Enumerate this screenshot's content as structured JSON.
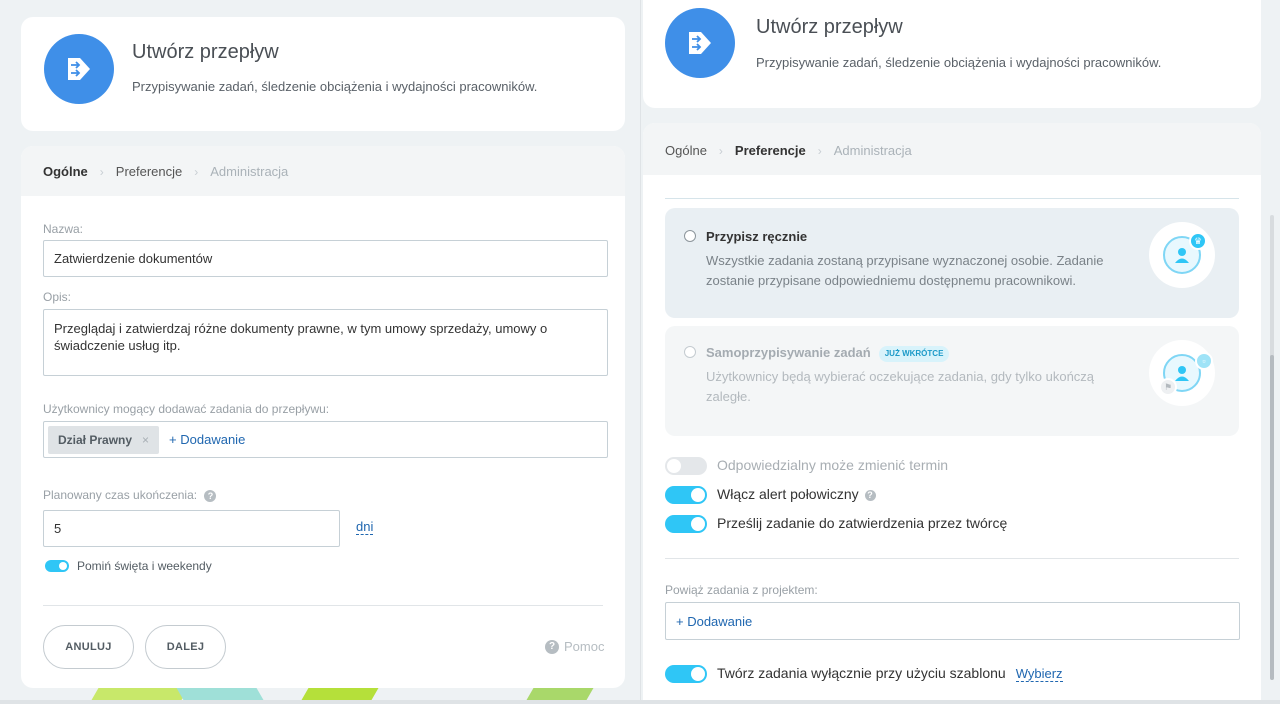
{
  "left": {
    "header": {
      "title": "Utwórz przepływ",
      "subtitle": "Przypisywanie zadań, śledzenie obciążenia i wydajności pracowników."
    },
    "tabs": [
      "Ogólne",
      "Preferencje",
      "Administracja"
    ],
    "form": {
      "name_label": "Nazwa:",
      "name_value": "Zatwierdzenie dokumentów",
      "desc_label": "Opis:",
      "desc_value": "Przeglądaj i zatwierdzaj różne dokumenty prawne, w tym umowy sprzedaży, umowy o świadczenie usług itp.",
      "users_label": "Użytkownicy mogący dodawać zadania do przepływu:",
      "users_chip": "Dział Prawny",
      "users_chip_remove": "×",
      "users_add": "+ Dodawanie",
      "time_label": "Planowany czas ukończenia:",
      "time_value": "5",
      "time_unit": "dni",
      "skip_toggle_label": "Pomiń święta i weekendy",
      "skip_toggle_on": true
    },
    "buttons": {
      "cancel": "ANULUJ",
      "next": "DALEJ",
      "help": "Pomoc"
    }
  },
  "right": {
    "header": {
      "title": "Utwórz przepływ",
      "subtitle": "Przypisywanie zadań, śledzenie obciążenia i wydajności pracowników."
    },
    "tabs": [
      "Ogólne",
      "Preferencje",
      "Administracja"
    ],
    "options": [
      {
        "title": "Przypisz ręcznie",
        "description": "Wszystkie zadania zostaną przypisane wyznaczonej osobie. Zadanie zostanie przypisane odpowiedniemu dostępnemu pracownikowi.",
        "badge": "",
        "selected": false,
        "disabled": false
      },
      {
        "title": "Samoprzypisywanie zadań",
        "description": "Użytkownicy będą wybierać oczekujące zadania, gdy tylko ukończą zaległe.",
        "badge": "JUŻ WKRÓTCE",
        "selected": false,
        "disabled": true
      }
    ],
    "settings": [
      {
        "label": "Odpowiedzialny może zmienić termin",
        "on": false
      },
      {
        "label": "Włącz alert połowiczny",
        "on": true
      },
      {
        "label": "Prześlij zadanie do zatwierdzenia przez twórcę",
        "on": true
      }
    ],
    "project_label": "Powiąż zadania z projektem:",
    "project_add": "+ Dodawanie",
    "template_setting": {
      "label": "Twórz zadania wyłącznie przy użyciu szablonu",
      "link": "Wybierz",
      "on": true
    }
  },
  "colors": {
    "accent": "#2fc6f6",
    "link": "#2067b0",
    "logo": "#3f8fe8"
  }
}
